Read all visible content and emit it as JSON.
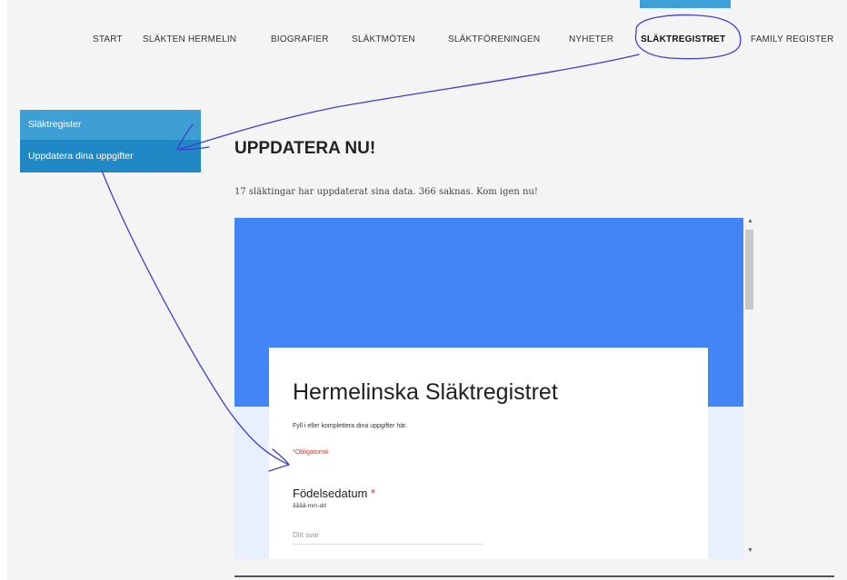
{
  "nav": {
    "items": [
      "START",
      "SLÄKTEN HERMELIN",
      "BIOGRAFIER",
      "SLÄKTMÖTEN",
      "SLÄKTFÖRENINGEN",
      "NYHETER",
      "SLÄKTREGISTRET",
      "FAMILY REGISTER"
    ],
    "active": "SLÄKTREGISTRET"
  },
  "sidebar": {
    "items": [
      "Släktregister",
      "Uppdatera dina uppgifter"
    ]
  },
  "page": {
    "heading": "UPPDATERA NU!",
    "status_text": "17 släktingar har uppdaterat sina data. 366 saknas. Kom igen nu!"
  },
  "form": {
    "title": "Hermelinska Släktregistret",
    "description": "Fyll i eller komplettera dina uppgifter här.",
    "required_note": "*Obligatorisk",
    "question": {
      "label": "Födelsedatum",
      "required_mark": "*",
      "format_hint": "åååå-mm-dd",
      "placeholder": "Ditt svar"
    }
  },
  "colors": {
    "accent": "#3ea0d6",
    "sidebar_active": "#2088c4",
    "form_banner": "#4285f4",
    "annotation": "#3f3fcf",
    "required": "#d93025"
  }
}
